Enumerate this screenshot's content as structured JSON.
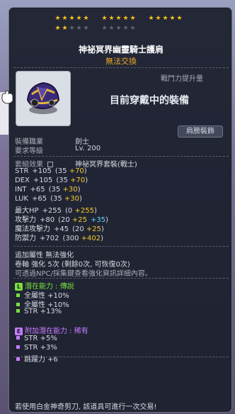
{
  "colors": {
    "star_on": "#f4c21c",
    "star_off": "#5f6574",
    "subtitle": "#e8a92a",
    "bonus_yellow": "#f2cc2a",
    "bonus_cyan": "#5fd6ff",
    "potential_green": "#7ae03e",
    "additional_purple": "#c87cff"
  },
  "stars": {
    "filled": 17,
    "total": 25
  },
  "item": {
    "name": "神祕冥界幽靈騎士護肩",
    "trade_status": "無法交換",
    "icon": "helmet-shoulder-icon"
  },
  "info": {
    "combat_power_label": "戰鬥力提升量",
    "equipped_text": "目前穿戴中的裝備",
    "equip_button": "肩膀裝飾",
    "job_label": "裝備職業",
    "job_value": "劍士",
    "level_label": "要求等級",
    "level_value": "Lv. 200"
  },
  "set_effect": {
    "label": "套組效果",
    "lock_icon": "lock-icon",
    "value": "神祕冥界套裝(戰士)"
  },
  "stats": [
    {
      "name": "STR",
      "total": "+105",
      "base": "(35 ",
      "add1": "+70",
      "add2": "",
      "close": ")"
    },
    {
      "name": "DEX",
      "total": "+105",
      "base": "(35 ",
      "add1": "+70",
      "add2": "",
      "close": ")"
    },
    {
      "name": "INT",
      "total": "+65",
      "base": "(35 ",
      "add1": "+30",
      "add2": "",
      "close": ")"
    },
    {
      "name": "LUK",
      "total": "+65",
      "base": "(35 ",
      "add1": "+30",
      "add2": "",
      "close": ")"
    },
    {
      "name": "最大HP",
      "total": "+255",
      "base": "(0 ",
      "add1": "+255",
      "add2": "",
      "close": ")"
    },
    {
      "name": "攻擊力",
      "total": "+80",
      "base": "(20 ",
      "add1": "+25",
      "add2": "+35",
      "close": ")"
    },
    {
      "name": "魔法攻擊力",
      "total": "+45",
      "base": "(20 ",
      "add1": "+25",
      "add2": "",
      "close": ")"
    },
    {
      "name": "防禦力",
      "total": "+702",
      "base": "(300 ",
      "add1": "+402",
      "add2": "",
      "close": ")"
    }
  ],
  "extra": {
    "line1": "追加屬性 無法強化",
    "line2": "卷軸 強化 5次 (剩餘0次, 可恢復0次)",
    "line3": "可透過NPC/採集鍵查看強化資訊詳細內容。"
  },
  "potential": {
    "badge": "L",
    "label": "潛在能力 : 傳說",
    "lines": [
      "全屬性 +10%",
      "全屬性 +10%",
      "STR +13%"
    ]
  },
  "additional_potential": {
    "badge": "E",
    "label": "附加潛在能力 : 稀有",
    "lines": [
      "STR +5%",
      "STR +3%",
      "跳躍力 +6"
    ]
  },
  "footer": "若使用白金神奇剪刀, 該道具可進行一次交易!"
}
